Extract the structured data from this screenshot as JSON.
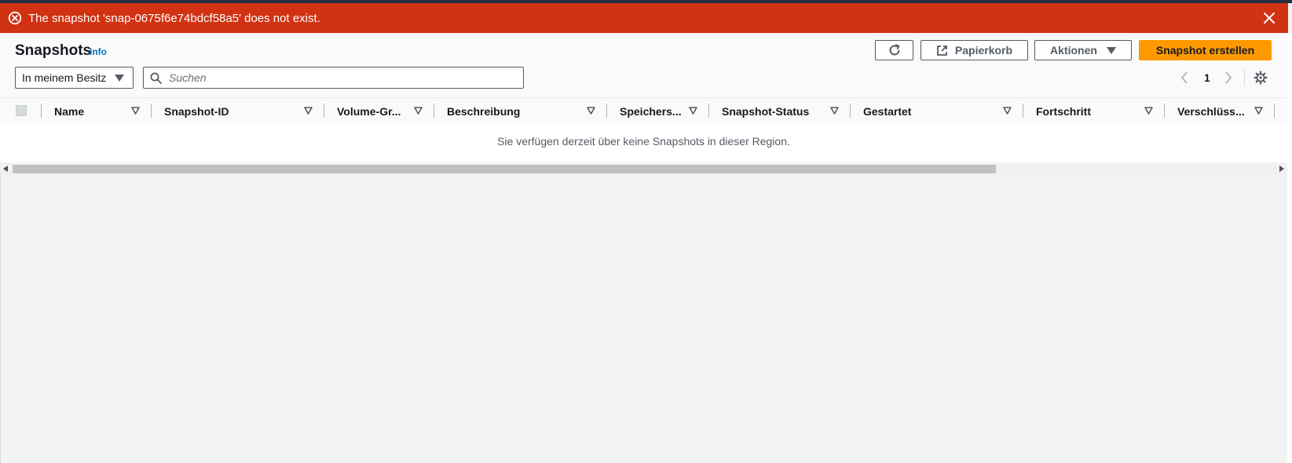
{
  "flash": {
    "message": "The snapshot 'snap-0675f6e74bdcf58a5' does not exist.",
    "icon": "error-circle-icon",
    "color": "#d13212"
  },
  "header": {
    "title": "Snapshots",
    "info": "Info",
    "trash_label": "Papierkorb",
    "actions_label": "Aktionen",
    "create_label": "Snapshot erstellen"
  },
  "filters": {
    "owner_selected": "In meinem Besitz",
    "search_placeholder": "Suchen"
  },
  "pagination": {
    "current_page": "1"
  },
  "table": {
    "columns": [
      "Name",
      "Snapshot-ID",
      "Volume-Gr...",
      "Beschreibung",
      "Speichers...",
      "Snapshot-Status",
      "Gestartet",
      "Fortschritt",
      "Verschlüss..."
    ],
    "empty_message": "Sie verfügen derzeit über keine Snapshots in dieser Region."
  },
  "colors": {
    "accent": "#ff9900",
    "link": "#0073bb",
    "error": "#d13212"
  }
}
